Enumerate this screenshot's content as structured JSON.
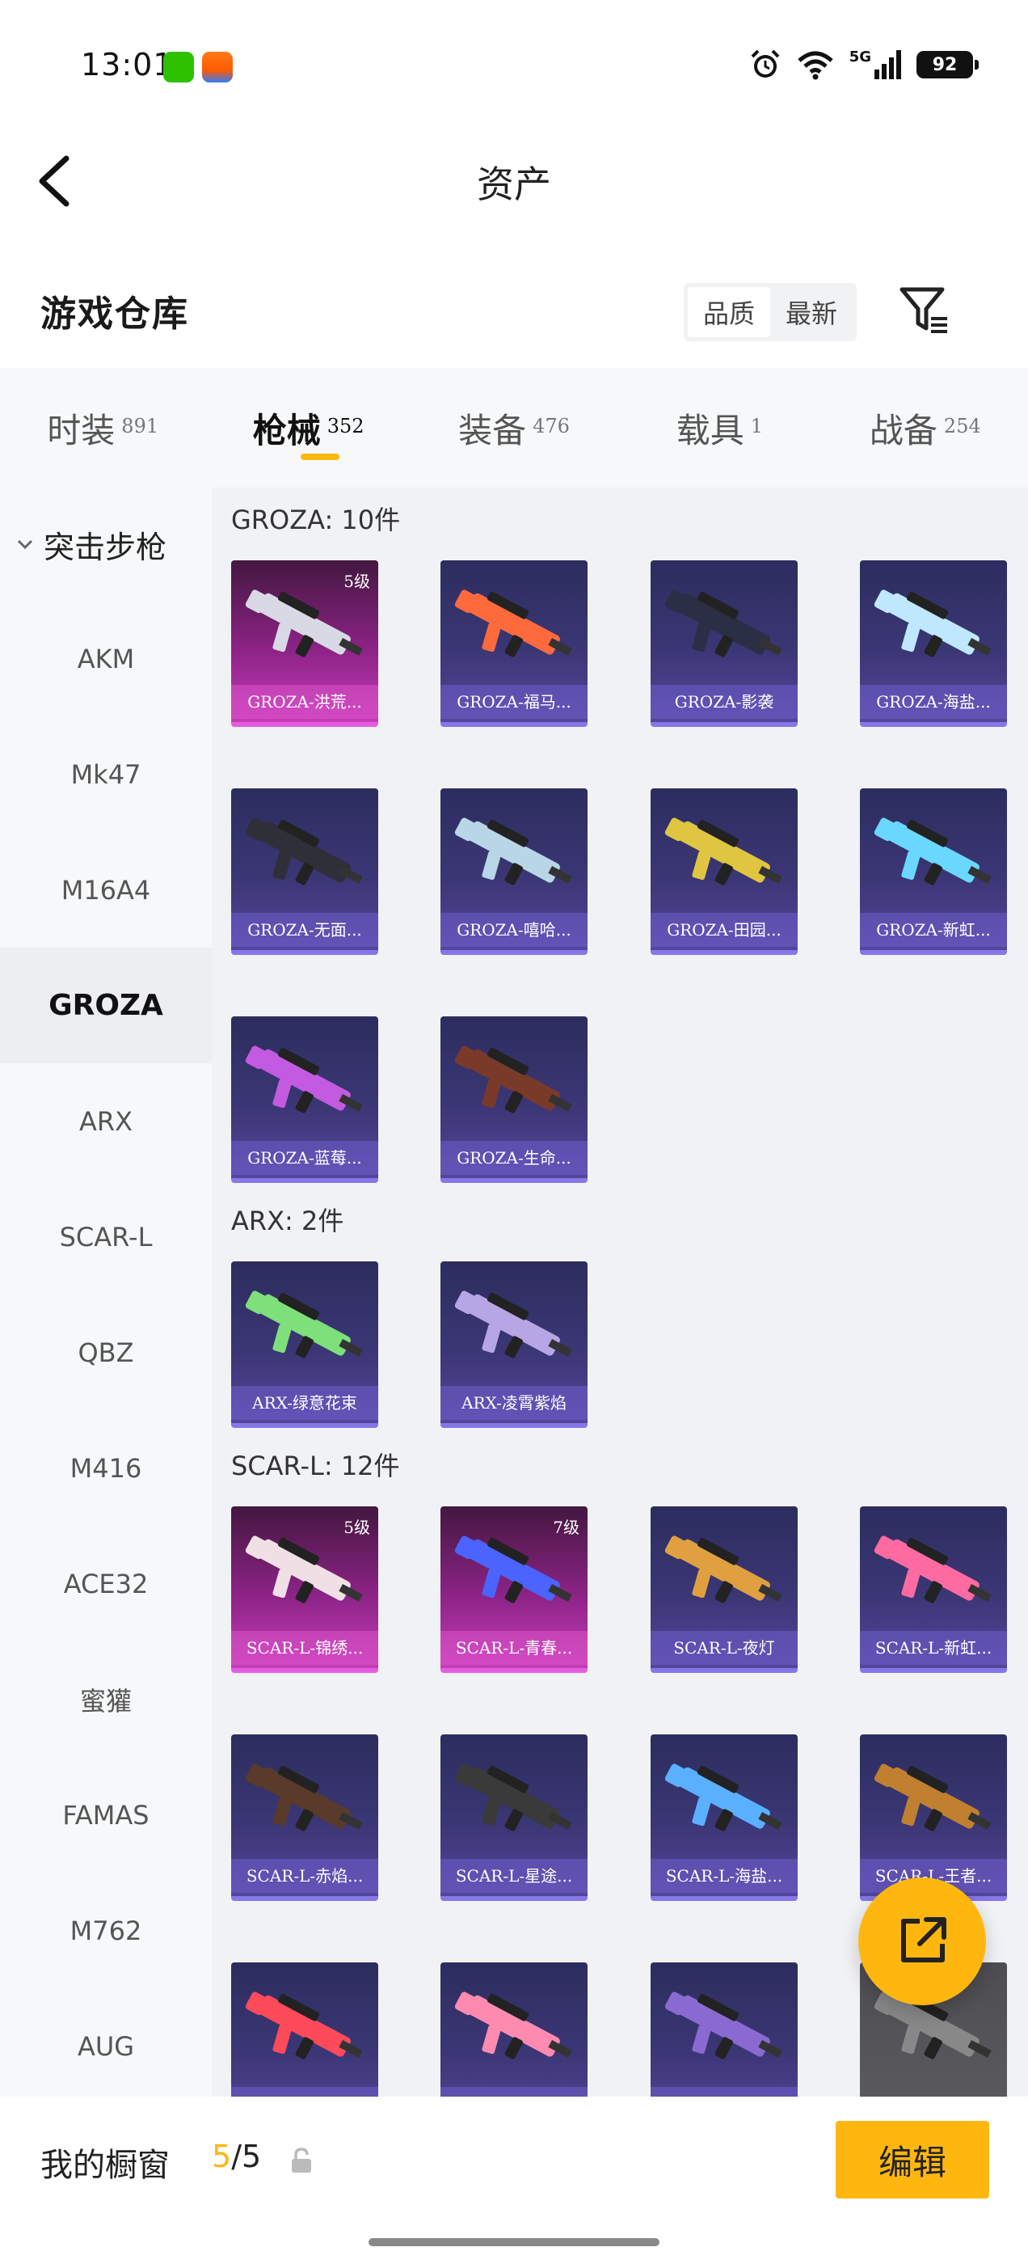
{
  "status_bar": {
    "time": "13:01",
    "network": "5G",
    "battery": "92"
  },
  "header": {
    "title": "资产"
  },
  "section": {
    "title": "游戏仓库",
    "sort_options": [
      {
        "label": "品质",
        "active": true
      },
      {
        "label": "最新",
        "active": false
      }
    ]
  },
  "tabs": [
    {
      "label": "时装",
      "count": "891",
      "active": false
    },
    {
      "label": "枪械",
      "count": "352",
      "active": true
    },
    {
      "label": "装备",
      "count": "476",
      "active": false
    },
    {
      "label": "载具",
      "count": "1",
      "active": false
    },
    {
      "label": "战备",
      "count": "254",
      "active": false
    }
  ],
  "sidebar": {
    "group": "突击步枪",
    "items": [
      {
        "label": "AKM"
      },
      {
        "label": "Mk47"
      },
      {
        "label": "M16A4"
      },
      {
        "label": "GROZA",
        "active": true
      },
      {
        "label": "ARX"
      },
      {
        "label": "SCAR-L"
      },
      {
        "label": "QBZ"
      },
      {
        "label": "M416"
      },
      {
        "label": "ACE32"
      },
      {
        "label": "蜜獾"
      },
      {
        "label": "FAMAS"
      },
      {
        "label": "M762"
      },
      {
        "label": "AUG"
      }
    ]
  },
  "groups": [
    {
      "header": "GROZA: 10件",
      "items": [
        {
          "name": "GROZA-洪荒...",
          "level": "5级",
          "rarity": "legendary"
        },
        {
          "name": "GROZA-福马...",
          "rarity": "epic"
        },
        {
          "name": "GROZA-影袭",
          "rarity": "epic"
        },
        {
          "name": "GROZA-海盐...",
          "rarity": "epic"
        },
        {
          "name": "GROZA-无面...",
          "rarity": "epic"
        },
        {
          "name": "GROZA-嘻哈...",
          "rarity": "epic"
        },
        {
          "name": "GROZA-田园...",
          "rarity": "epic"
        },
        {
          "name": "GROZA-新虹...",
          "rarity": "epic"
        },
        {
          "name": "GROZA-蓝莓...",
          "rarity": "epic"
        },
        {
          "name": "GROZA-生命...",
          "rarity": "epic"
        }
      ]
    },
    {
      "header": "ARX: 2件",
      "items": [
        {
          "name": "ARX-绿意花束",
          "rarity": "epic"
        },
        {
          "name": "ARX-凌霄紫焰",
          "rarity": "epic"
        }
      ]
    },
    {
      "header": "SCAR-L: 12件",
      "items": [
        {
          "name": "SCAR-L-锦绣...",
          "level": "5级",
          "rarity": "legendary"
        },
        {
          "name": "SCAR-L-青春...",
          "level": "7级",
          "rarity": "legendary"
        },
        {
          "name": "SCAR-L-夜灯",
          "rarity": "epic"
        },
        {
          "name": "SCAR-L-新虹...",
          "rarity": "epic"
        },
        {
          "name": "SCAR-L-赤焰...",
          "rarity": "epic"
        },
        {
          "name": "SCAR-L-星途...",
          "rarity": "epic"
        },
        {
          "name": "SCAR-L-海盐...",
          "rarity": "epic"
        },
        {
          "name": "SCAR-L-王者...",
          "rarity": "epic"
        },
        {
          "name": "",
          "rarity": "epic"
        },
        {
          "name": "",
          "rarity": "epic"
        },
        {
          "name": "",
          "rarity": "epic"
        },
        {
          "name": "",
          "rarity": "common"
        }
      ]
    }
  ],
  "bottom_bar": {
    "label": "我的橱窗",
    "count_current": "5",
    "count_total": "/5",
    "edit_label": "编辑"
  },
  "colors": {
    "accent": "#ffb70f",
    "epic_card": "#3b3675",
    "legendary_card": "#8c2386"
  },
  "icons": {
    "back": "back-arrow-icon",
    "filter": "filter-icon",
    "share": "share-external-icon",
    "lock": "lock-icon",
    "chevron": "chevron-down-icon"
  }
}
